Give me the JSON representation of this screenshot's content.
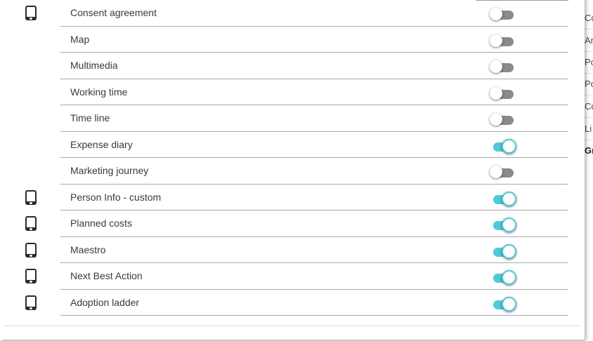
{
  "background_panel": {
    "rows": [
      "Co",
      "Ar",
      "Po",
      "Po",
      "Co",
      "Li",
      "Gr"
    ]
  },
  "modules": [
    {
      "label": "Consent agreement",
      "device_icon": "tablet-icon",
      "has_device_icon": true,
      "enabled": false
    },
    {
      "label": "Map",
      "device_icon": "",
      "has_device_icon": false,
      "enabled": false
    },
    {
      "label": "Multimedia",
      "device_icon": "",
      "has_device_icon": false,
      "enabled": false
    },
    {
      "label": "Working time",
      "device_icon": "",
      "has_device_icon": false,
      "enabled": false
    },
    {
      "label": "Time line",
      "device_icon": "",
      "has_device_icon": false,
      "enabled": false
    },
    {
      "label": "Expense diary",
      "device_icon": "",
      "has_device_icon": false,
      "enabled": true
    },
    {
      "label": "Marketing journey",
      "device_icon": "",
      "has_device_icon": false,
      "enabled": false
    },
    {
      "label": "Person Info - custom",
      "device_icon": "tablet-icon",
      "has_device_icon": true,
      "enabled": true
    },
    {
      "label": "Planned costs",
      "device_icon": "tablet-icon",
      "has_device_icon": true,
      "enabled": true
    },
    {
      "label": "Maestro",
      "device_icon": "tablet-icon",
      "has_device_icon": true,
      "enabled": true
    },
    {
      "label": "Next Best Action",
      "device_icon": "tablet-icon",
      "has_device_icon": true,
      "enabled": true
    },
    {
      "label": "Adoption ladder",
      "device_icon": "tablet-icon",
      "has_device_icon": true,
      "enabled": true
    }
  ],
  "colors": {
    "toggle_on": "#4fcad9",
    "toggle_off": "#8a8a8a",
    "divider": "#a8a8a8",
    "text": "#3a3a3a"
  }
}
